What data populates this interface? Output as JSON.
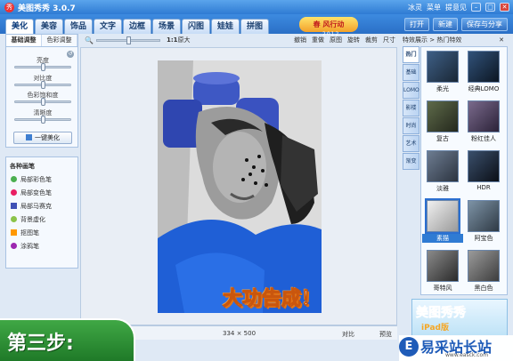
{
  "titlebar": {
    "title": "美图秀秀 3.0.7",
    "user": "冰灵",
    "menu": "菜单",
    "feedback": "提意见"
  },
  "tabs": [
    "美化",
    "美容",
    "饰品",
    "文字",
    "边框",
    "场景",
    "闪图",
    "娃娃",
    "拼图"
  ],
  "promo": {
    "text": "春 风行动",
    "sub": "2012"
  },
  "header_actions": {
    "open": "打开",
    "new": "新建",
    "save_share": "保存与分享"
  },
  "left_panel": {
    "tabs": [
      "基础调整",
      "色彩调整"
    ],
    "sliders": [
      {
        "label": "亮度",
        "value": 0.5
      },
      {
        "label": "对比度",
        "value": 0.5
      },
      {
        "label": "色彩饱和度",
        "value": 0.5
      },
      {
        "label": "清晰度",
        "value": 0.5
      }
    ],
    "beautify_button": "一键美化"
  },
  "pens": {
    "title": "各种画笔",
    "items": [
      "局部彩色笔",
      "局部变色笔",
      "局部马赛克",
      "背景虚化",
      "抠图笔",
      "涂鸦笔"
    ]
  },
  "toolbar": {
    "zoom_value": 0.5,
    "ratio": "1:1",
    "original": "原大",
    "tools": [
      "撤销",
      "重做",
      "原图",
      "旋转",
      "裁剪",
      "尺寸"
    ]
  },
  "overlay": {
    "done_text": "大功告成！"
  },
  "status": {
    "dims": "334 × 500",
    "compare": "对比",
    "fullscreen": "预览"
  },
  "right_panel": {
    "header": "特效展示 > 热门特效",
    "close": "✕",
    "categories": [
      "热门",
      "基础",
      "LOMO",
      "影楼",
      "时尚",
      "艺术",
      "渐变"
    ],
    "effects": [
      {
        "label": "柔光",
        "colors": [
          "#3e5f86",
          "#1a2735"
        ]
      },
      {
        "label": "经典LOMO",
        "colors": [
          "#31527a",
          "#0c1622"
        ]
      },
      {
        "label": "复古",
        "colors": [
          "#5e6a4a",
          "#24281c"
        ]
      },
      {
        "label": "粉红佳人",
        "colors": [
          "#7a6a8c",
          "#2b2238"
        ]
      },
      {
        "label": "淡雅",
        "colors": [
          "#6d7c91",
          "#2c3440"
        ]
      },
      {
        "label": "HDR",
        "colors": [
          "#3a4f6b",
          "#0b0f17"
        ]
      },
      {
        "label": "素描",
        "colors": [
          "#f0f0f0",
          "#9a9a9a"
        ]
      },
      {
        "label": "阿宝色",
        "colors": [
          "#7d93a6",
          "#2f3a45"
        ]
      },
      {
        "label": "哥特风",
        "colors": [
          "#8a8a8a",
          "#2a2a2a"
        ]
      },
      {
        "label": "黑白色",
        "colors": [
          "#9b9b9b",
          "#3d3d3d"
        ]
      }
    ],
    "selected_index": 6
  },
  "ad": {
    "text": "美图秀秀",
    "sub": "iPad版"
  },
  "step_banner": "第三步:",
  "watermark": {
    "logo": "E",
    "text": "易采站长站",
    "url": "www.easck.com"
  },
  "colors": {
    "accent": "#2f7bd3",
    "green": "#2e8f35"
  }
}
